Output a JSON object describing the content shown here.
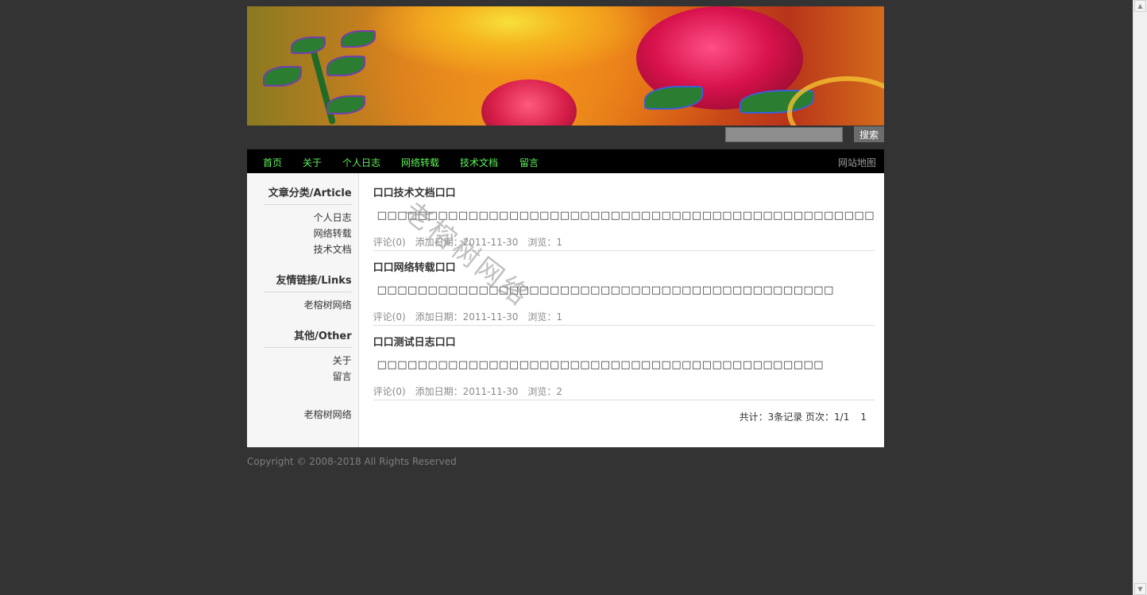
{
  "search": {
    "placeholder": "",
    "button_label": "搜索"
  },
  "nav": {
    "items": [
      "首页",
      "关于",
      "个人日志",
      "网络转载",
      "技术文档",
      "留言"
    ],
    "sitemap_label": "网站地图",
    "link_color": "#5df25a"
  },
  "sidebar": {
    "article_heading": "文章分类/Article",
    "articles": [
      "个人日志",
      "网络转载",
      "技术文档"
    ],
    "links_heading": "友情链接/Links",
    "links": [
      "老榕树网络"
    ],
    "other_heading": "其他/Other",
    "other": [
      "关于",
      "留言"
    ],
    "bottom_link": "老榕树网络"
  },
  "posts": [
    {
      "title": "口口技术文档口口",
      "body": "□□□□□□□□□□□□□□□□□□□□□□□□□□□□□□□□□□□□□□□□□□□□□□□□□",
      "comments": "评论(0)",
      "date": "添加日期：2011-11-30",
      "views": "浏览：1"
    },
    {
      "title": "口口网络转载口口",
      "body": "□□□□□□□□□□□□□□□□□□□□□□□□□□□□□□□□□□□□□□□□□□□□□",
      "comments": "评论(0)",
      "date": "添加日期：2011-11-30",
      "views": "浏览：1"
    },
    {
      "title": "口口测试日志口口",
      "body": "□□□□□□□□□□□□□□□□□□□□□□□□□□□□□□□□□□□□□□□□□□□□",
      "comments": "评论(0)",
      "date": "添加日期：2011-11-30",
      "views": "浏览：2"
    }
  ],
  "pager": {
    "summary": "共计：3条记录 页次：1/1",
    "page": "1"
  },
  "footer": {
    "copyright": "Copyright © 2008-2018 All Rights Reserved"
  },
  "watermark": "老榕树网络"
}
